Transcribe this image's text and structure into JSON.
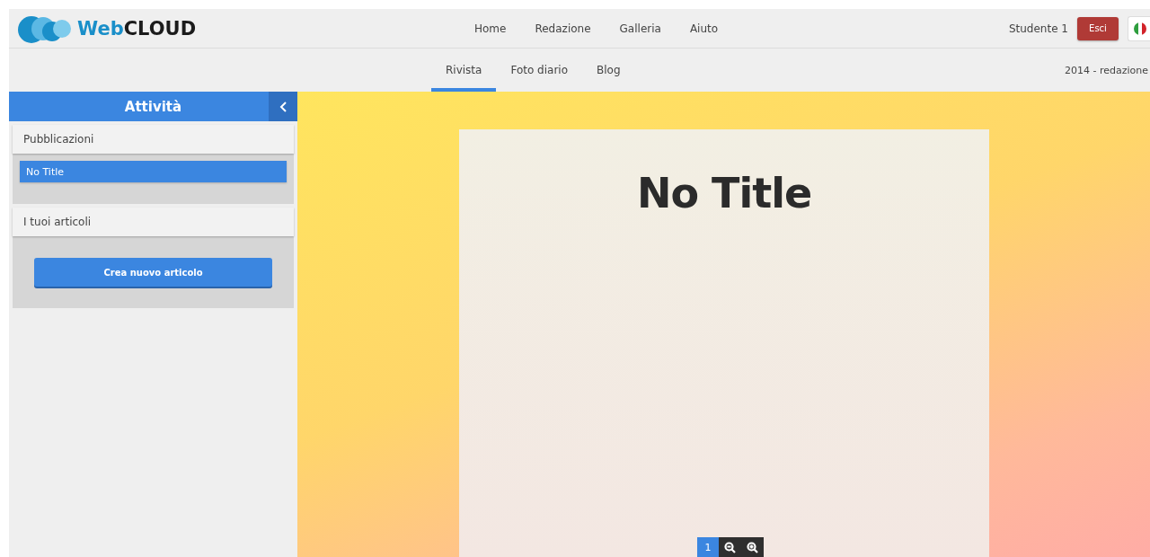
{
  "logo": {
    "brand_start": "Web",
    "brand_end": "CLOUD"
  },
  "main_nav": [
    {
      "label": "Home"
    },
    {
      "label": "Redazione"
    },
    {
      "label": "Galleria"
    },
    {
      "label": "Aiuto"
    }
  ],
  "user": {
    "name": "Studente 1",
    "logout": "Esci"
  },
  "sub_nav": [
    {
      "label": "Rivista",
      "selected": true
    },
    {
      "label": "Foto diario",
      "selected": false
    },
    {
      "label": "Blog",
      "selected": false
    }
  ],
  "edition": "2014 - redazione",
  "sidebar": {
    "title": "Attività",
    "sections": [
      {
        "title": "Pubblicazioni",
        "items": [
          {
            "label": "No Title",
            "selected": true
          }
        ]
      },
      {
        "title": "I tuoi articoli",
        "button": "Crea nuovo articolo"
      }
    ]
  },
  "page": {
    "title": "No Title",
    "pager": {
      "page": "1"
    }
  }
}
